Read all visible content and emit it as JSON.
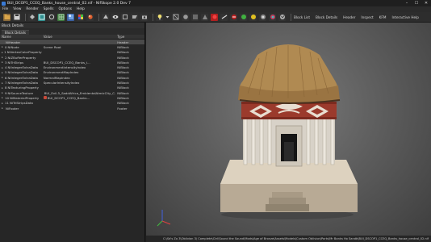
{
  "window": {
    "title": "BUI_DCOP1_CCEQ_Banks_house_central_02.nif - NifSkope 2.0 Dev 7",
    "controls": [
      "–",
      "☐",
      "✕"
    ]
  },
  "menu": [
    "File",
    "View",
    "Render",
    "Spells",
    "Options",
    "Help"
  ],
  "toolbar": {
    "labels": [
      "Block List",
      "Block Details",
      "Header",
      "Inspect",
      "KFM",
      "Interactive Help"
    ]
  },
  "left_panel": {
    "title": "Block Details",
    "tab": "Block Details",
    "columns": [
      "Name",
      "Value",
      "Type"
    ],
    "rows": [
      {
        "num": "",
        "name": "NiHeader",
        "value": "",
        "type": "Header",
        "selected": true,
        "has_arrow": false,
        "thumb": ""
      },
      {
        "num": "0",
        "name": "NiNode",
        "value": "Scene Root",
        "type": "NiBlock",
        "selected": false,
        "has_arrow": true,
        "thumb": ""
      },
      {
        "num": "1",
        "name": "NiVertexColorProperty",
        "value": "",
        "type": "NiBlock",
        "selected": false,
        "has_arrow": true,
        "thumb": ""
      },
      {
        "num": "2",
        "name": "NiZBufferProperty",
        "value": "",
        "type": "NiBlock",
        "selected": false,
        "has_arrow": true,
        "thumb": ""
      },
      {
        "num": "3",
        "name": "NiTriStrips",
        "value": "BUI_DSCOP1_CCEQ_Banks_i...",
        "type": "NiBlock",
        "selected": false,
        "has_arrow": true,
        "thumb": ""
      },
      {
        "num": "4",
        "name": "NiIntegerExtraData",
        "value": "EnvironmentIntensityIndex",
        "type": "NiBlock",
        "selected": false,
        "has_arrow": true,
        "thumb": ""
      },
      {
        "num": "5",
        "name": "NiIntegerExtraData",
        "value": "EnvironmentMapIndex",
        "type": "NiBlock",
        "selected": false,
        "has_arrow": true,
        "thumb": ""
      },
      {
        "num": "6",
        "name": "NiIntegerExtraData",
        "value": "NormalMapIndex",
        "type": "NiBlock",
        "selected": false,
        "has_arrow": true,
        "thumb": ""
      },
      {
        "num": "7",
        "name": "NiIntegerExtraData",
        "value": "SpecularIntensityIndex",
        "type": "NiBlock",
        "selected": false,
        "has_arrow": true,
        "thumb": ""
      },
      {
        "num": "8",
        "name": "NiTexturingProperty",
        "value": "",
        "type": "NiBlock",
        "selected": false,
        "has_arrow": true,
        "thumb": ""
      },
      {
        "num": "9",
        "name": "NiSourceTexture",
        "value": "BUI_Evil-5_SaddAfrica_EmbientalAtmicCity_C...",
        "type": "NiBlock",
        "selected": false,
        "has_arrow": true,
        "thumb": "#b89058"
      },
      {
        "num": "10",
        "name": "NiMaterialProperty",
        "value": "BUI_DCOP1_CCEQ_Banks...",
        "type": "NiBlock",
        "selected": false,
        "has_arrow": true,
        "thumb": "#c94a3a"
      },
      {
        "num": "11",
        "name": "NiTriStripsData",
        "value": "",
        "type": "NiBlock",
        "selected": false,
        "has_arrow": true,
        "thumb": ""
      },
      {
        "num": "",
        "name": "NiFooter",
        "value": "",
        "type": "Footer",
        "selected": false,
        "has_arrow": true,
        "thumb": ""
      }
    ]
  },
  "status": {
    "path": "C:\\Sd's Zo 3\\Oblivion 3\\ Complete\\Ctrl\\Sound the Sound\\Mods\\Age of Bronze\\Assets\\Models\\Custom Oblivion\\Ports\\Mr Banks Ho Sandb\\BUI_DSCOP1_CCEQ_Banks_house_central_02.nif"
  },
  "colors": {
    "accent": "#3a7bd5",
    "selected_row": "#4a4a4a"
  }
}
